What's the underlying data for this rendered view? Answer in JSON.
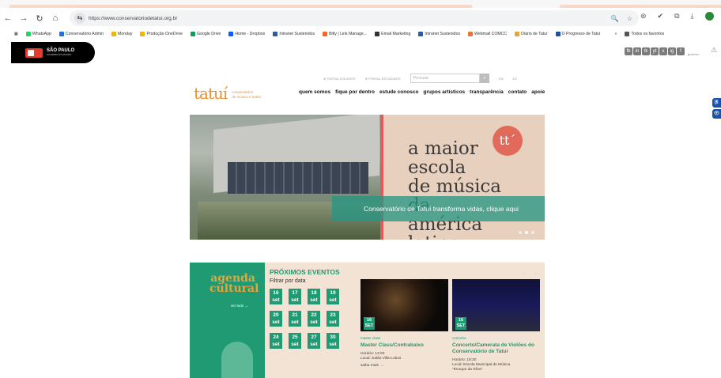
{
  "browser": {
    "url": "https://www.conservatoriodetatui.org.br",
    "bookmarks": [
      "WhatsApp",
      "Conservatório Admin",
      "Monday",
      "Produção OneDrive",
      "Google Drive",
      "Home - Dropbox",
      "Intranet Sustenidos",
      "Bitly | Link Manage...",
      "Email Marketing",
      "Intranet Sustenidos",
      "Webmail COMCC",
      "Diário de Tatuí",
      "O Progresso de Tatuí",
      "»",
      "Todos os favoritos"
    ],
    "bookmark_colors": [
      "#25d366",
      "#1a73e8",
      "#f6b400",
      "#f4b400",
      "#0f9d58",
      "#0061fe",
      "#2a5aa8",
      "#f26b21",
      "#333333",
      "#2a5aa8",
      "#e8763a",
      "#e8a33a",
      "#1a53a6",
      "#ffffff",
      "#555555"
    ]
  },
  "header": {
    "gov_logo": {
      "title": "SÃO PAULO",
      "sub": "GOVERNO DO ESTADO"
    },
    "social_icons": [
      "fb",
      "in",
      "tk",
      "yt",
      "x",
      "ig",
      "f"
    ],
    "gov_label": "governo",
    "warning_icon": "⚠",
    "accessibility": [
      "♿",
      "👁"
    ]
  },
  "topbar": {
    "portal_docente": "PORTAL DOCENTE",
    "portal_estudante": "PORTAL ESTUDANTE",
    "search_placeholder": "Procurar",
    "lang_en": "EN",
    "lang_es": "ES"
  },
  "logo": {
    "wordmark": "tatuí",
    "line1": "conservatório",
    "line2": "de música e teatro"
  },
  "menu": [
    "quem somos",
    "fique por dentro",
    "estude conosco",
    "grupos artísticos",
    "transparência",
    "contato",
    "apoie"
  ],
  "hero": {
    "headline_lines": [
      "a maior",
      "escola",
      "de música",
      "da",
      "américa",
      "latina"
    ],
    "mark": "tt´",
    "overlay": "Conservatório de Tatuí transforma vidas, clique aqui",
    "dots": 3,
    "active_dot": 1
  },
  "agenda": {
    "title_lines": [
      "agenda",
      "cultural"
    ],
    "see_all": "ver tudo →",
    "events_title": "PRÓXIMOS EVENTOS",
    "filter_label": "Filtrar por data",
    "month": "set",
    "days": [
      "16",
      "17",
      "18",
      "19",
      "20",
      "21",
      "22",
      "23",
      "24",
      "25",
      "27",
      "30"
    ],
    "events": [
      {
        "day": "16",
        "month": "SET",
        "category": "master class",
        "title": "Master Class/Contrabaixo",
        "info": [
          "Horário: 14:00",
          "Local: Salão Villa-Lobos"
        ],
        "more": "saiba mais →"
      },
      {
        "day": "16",
        "month": "SET",
        "category": "concerto",
        "title": "Concerto/Camerata de Violões do Conservatório de Tatuí",
        "info": [
          "Horário: 19:30",
          "Local: Escola Municipal de Música",
          "\"Enoque da Silva\""
        ],
        "more": ""
      }
    ]
  }
}
